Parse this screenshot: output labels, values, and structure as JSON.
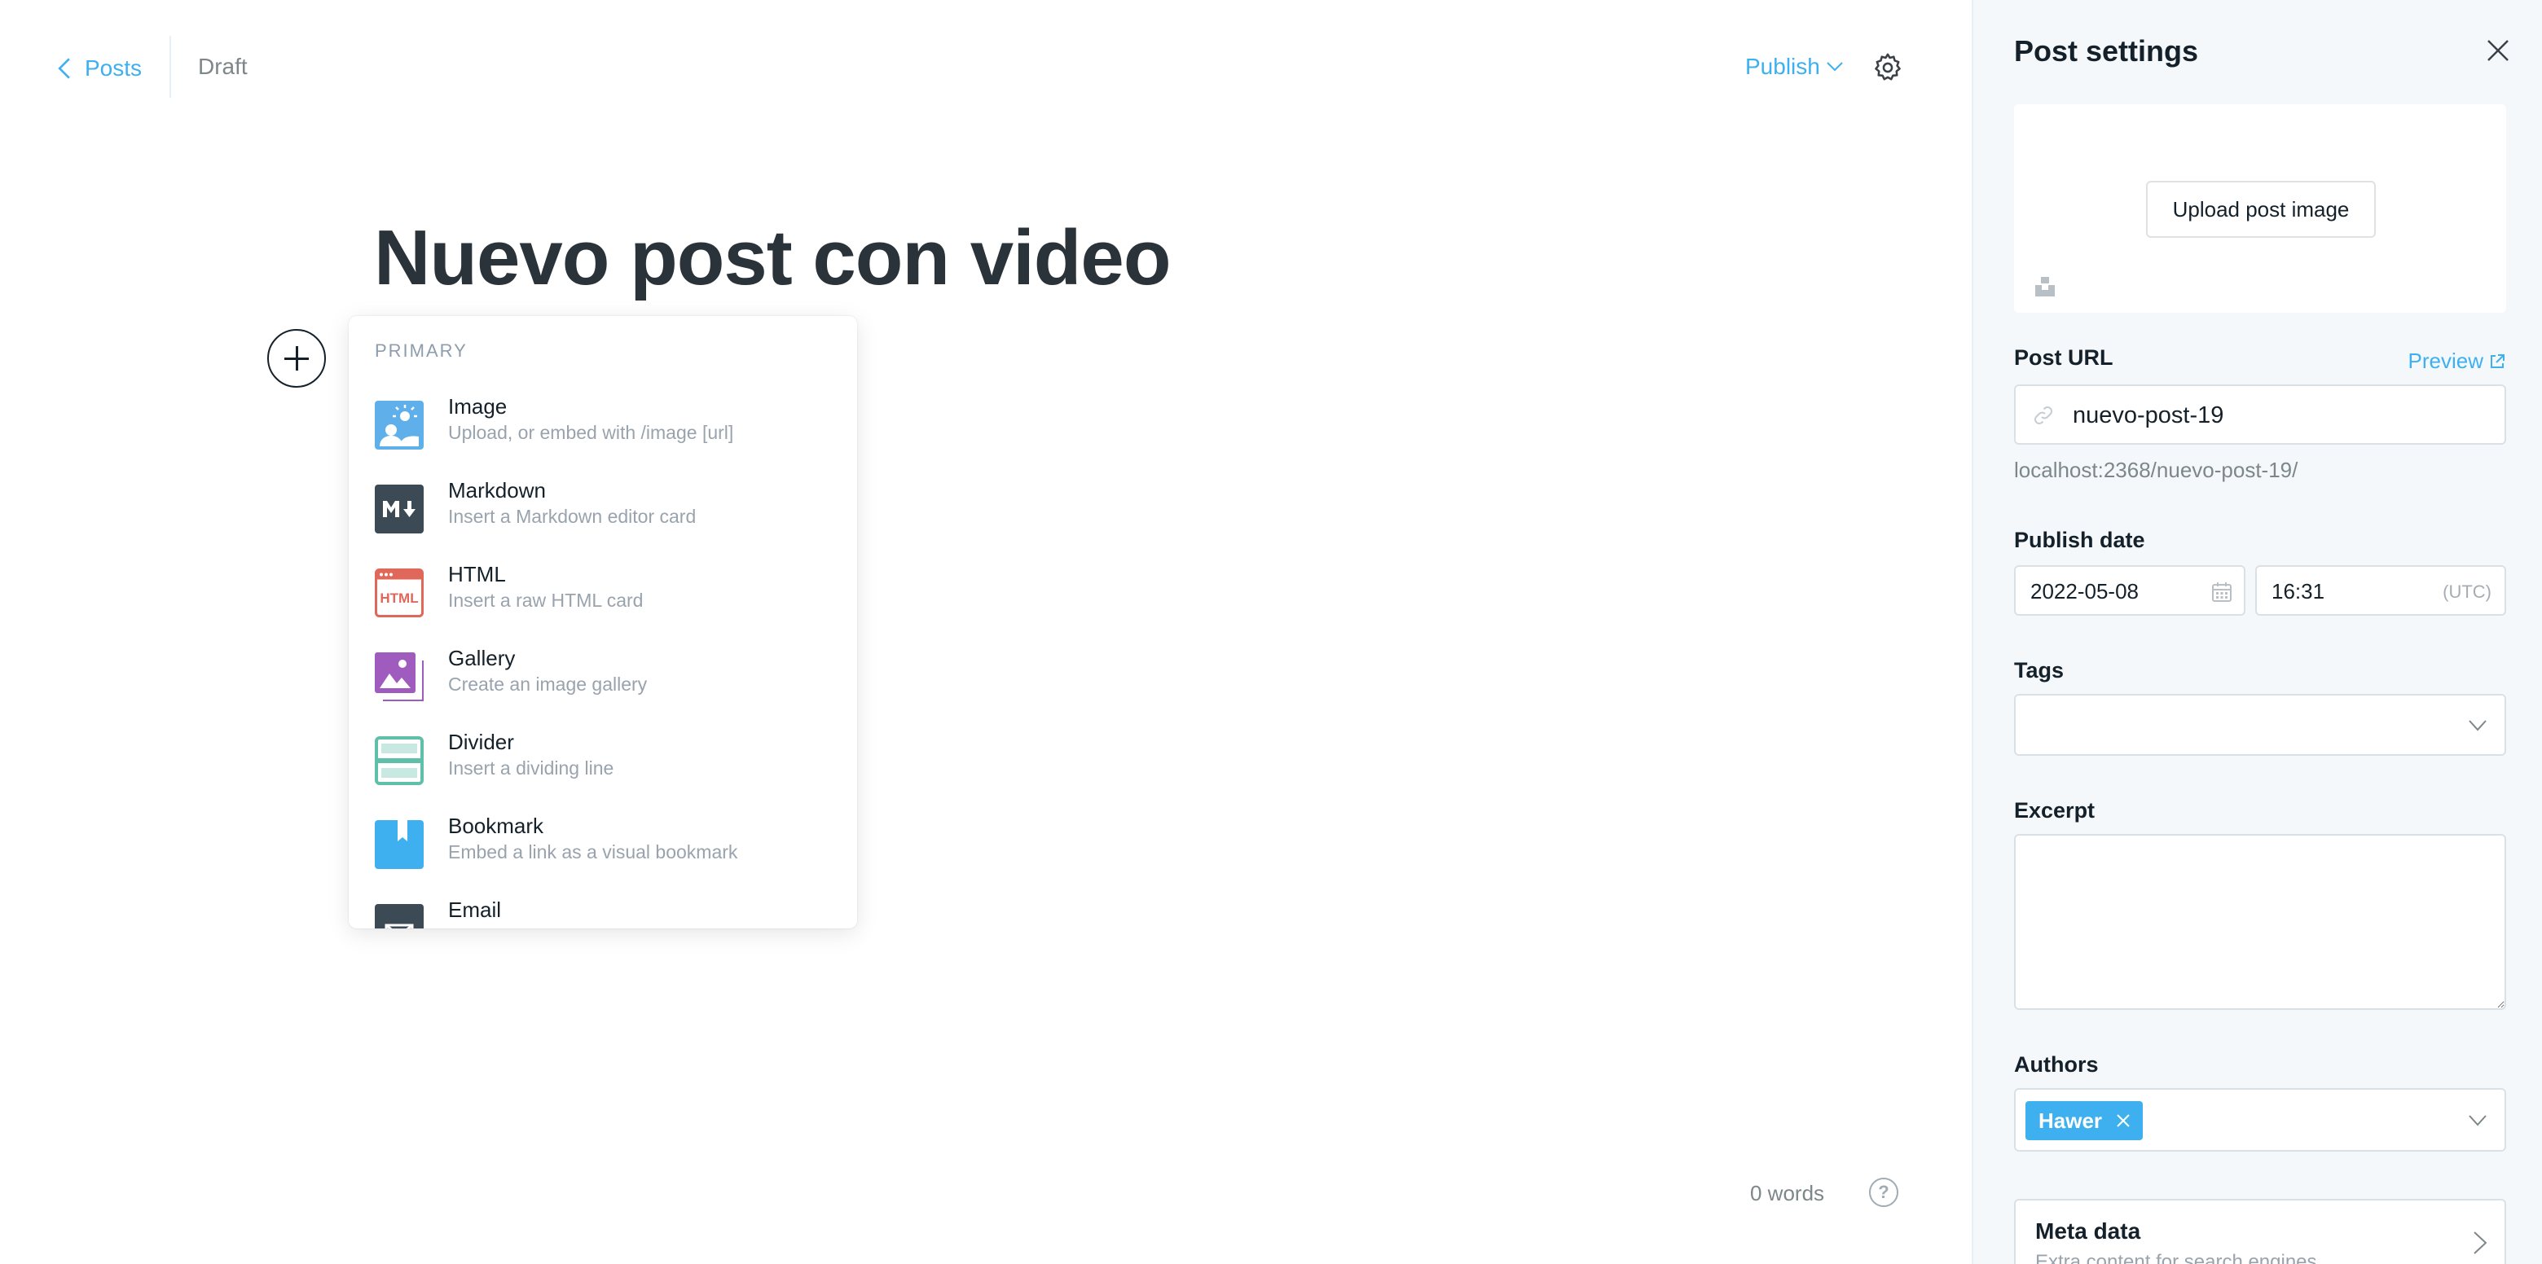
{
  "topbar": {
    "back_label": "Posts",
    "status": "Draft",
    "publish_label": "Publish"
  },
  "editor": {
    "title": "Nuevo post con video",
    "word_count": "0 words",
    "help_label": "?"
  },
  "card_menu": {
    "section": "PRIMARY",
    "items": [
      {
        "name": "Image",
        "desc": "Upload, or embed with /image [url]",
        "icon": "image-icon",
        "color": "#5fb0ea"
      },
      {
        "name": "Markdown",
        "desc": "Insert a Markdown editor card",
        "icon": "markdown-icon",
        "color": "#3c4a55"
      },
      {
        "name": "HTML",
        "desc": "Insert a raw HTML card",
        "icon": "html-icon",
        "color": "#e0685a"
      },
      {
        "name": "Gallery",
        "desc": "Create an image gallery",
        "icon": "gallery-icon",
        "color": "#a05bbf"
      },
      {
        "name": "Divider",
        "desc": "Insert a dividing line",
        "icon": "divider-icon",
        "color": "#5fbfa8"
      },
      {
        "name": "Bookmark",
        "desc": "Embed a link as a visual bookmark",
        "icon": "bookmark-icon",
        "color": "#3eb0ef"
      },
      {
        "name": "Email",
        "desc": "",
        "icon": "email-icon",
        "color": "#3c4a55"
      }
    ]
  },
  "panel": {
    "title": "Post settings",
    "upload_label": "Upload post image",
    "url_label": "Post URL",
    "preview_label": "Preview",
    "slug": "nuevo-post-19",
    "url_hint": "localhost:2368/nuevo-post-19/",
    "publish_date_label": "Publish date",
    "date": "2022-05-08",
    "time": "16:31",
    "timezone": "(UTC)",
    "tags_label": "Tags",
    "excerpt_label": "Excerpt",
    "authors_label": "Authors",
    "author": "Hawer",
    "meta_title": "Meta data",
    "meta_desc": "Extra content for search engines"
  }
}
